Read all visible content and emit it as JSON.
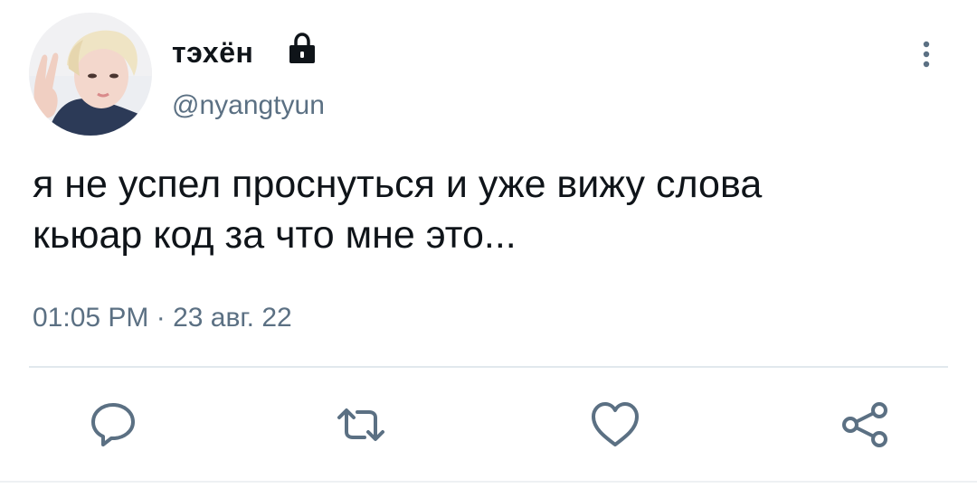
{
  "tweet": {
    "display_name": "тэхён",
    "handle": "@nyangtyun",
    "text": "я не успел проснуться и уже вижу слова\nкьюар код за что мне это...",
    "timestamp": "01:05 PM · 23 авг. 22",
    "protected_icon": "lock-icon",
    "avatar_icon": "avatar"
  },
  "actions": {
    "reply_icon": "reply-icon",
    "retweet_icon": "retweet-icon",
    "like_icon": "heart-icon",
    "share_icon": "share-icon"
  },
  "colors": {
    "text": "#0f1419",
    "secondary": "#5b7083",
    "divider": "#e1e8ed"
  }
}
